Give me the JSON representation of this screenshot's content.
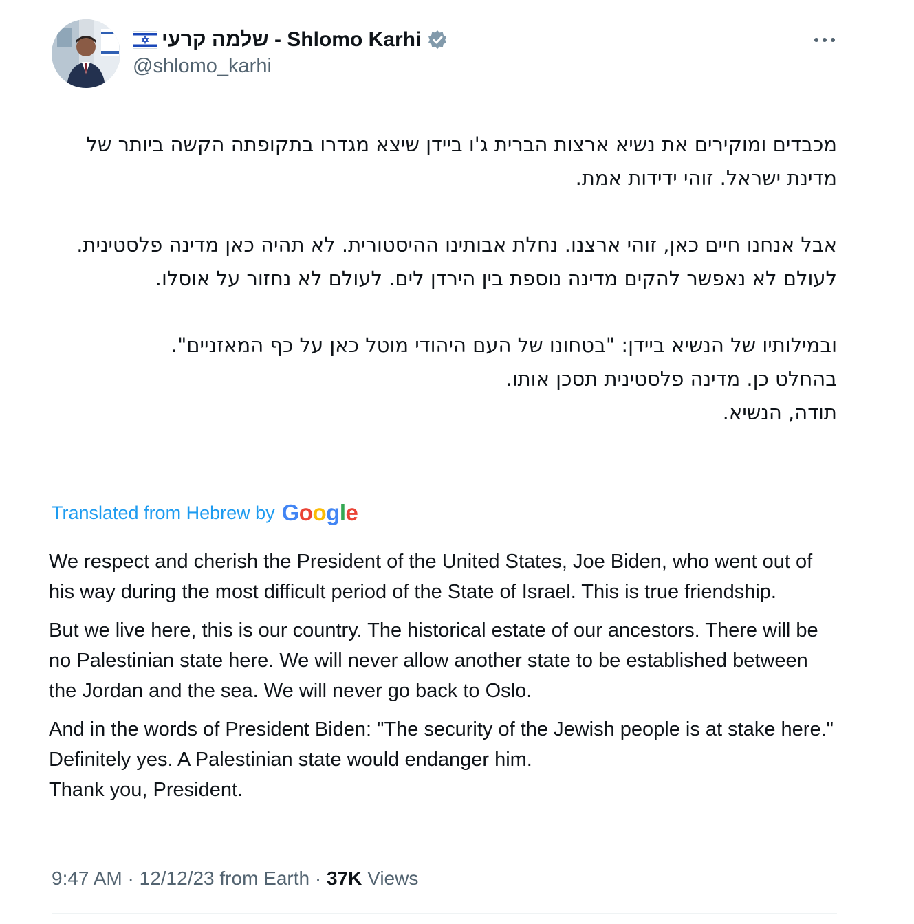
{
  "author": {
    "display_name": "שלמה קרעי - Shlomo Karhi",
    "handle": "@shlomo_karhi",
    "flag": "israel-flag",
    "verified": true
  },
  "tweet": {
    "hebrew_paragraphs": [
      "מכבדים ומוקירים את נשיא ארצות הברית ג'ו ביידן שיצא מגדרו בתקופתה הקשה ביותר של מדינת ישראל. זוהי ידידות אמת.",
      "אבל אנחנו חיים כאן, זוהי ארצנו. נחלת אבותינו ההיסטורית. לא תהיה כאן מדינה פלסטינית. לעולם לא נאפשר להקים מדינה נוספת בין הירדן לים. לעולם לא נחזור על אוסלו.",
      "ובמילותיו של הנשיא ביידן: \"בטחונו של העם היהודי מוטל כאן על כף המאזניים\".\nבהחלט כן. מדינה פלסטינית תסכן אותו.\nתודה, הנשיא."
    ],
    "translation_label": "Translated from Hebrew by",
    "translation_provider": "Google",
    "english_paragraphs": [
      "We respect and cherish the President of the United States, Joe Biden, who went out of his way during the most difficult period of the State of Israel. This is true friendship.",
      "But we live here, this is our country. The historical estate of our ancestors. There will be no Palestinian state here. We will never allow another state to be established between the Jordan and the sea. We will never go back to Oslo.",
      "And in the words of President Biden: \"The security of the Jewish people is at stake here.\" Definitely yes. A Palestinian state would endanger him.\nThank you, President."
    ]
  },
  "meta": {
    "time": "9:47 AM",
    "separator": "·",
    "date": "12/12/23",
    "source": "from Earth",
    "views_count": "37K",
    "views_label": "Views"
  },
  "colors": {
    "accent": "#1d9bf0",
    "secondary_text": "#536471",
    "primary_text": "#0f1419",
    "verified_badge": "#829aab"
  },
  "icons": {
    "more": "more-horizontal-icon",
    "verified": "verified-badge-icon"
  }
}
